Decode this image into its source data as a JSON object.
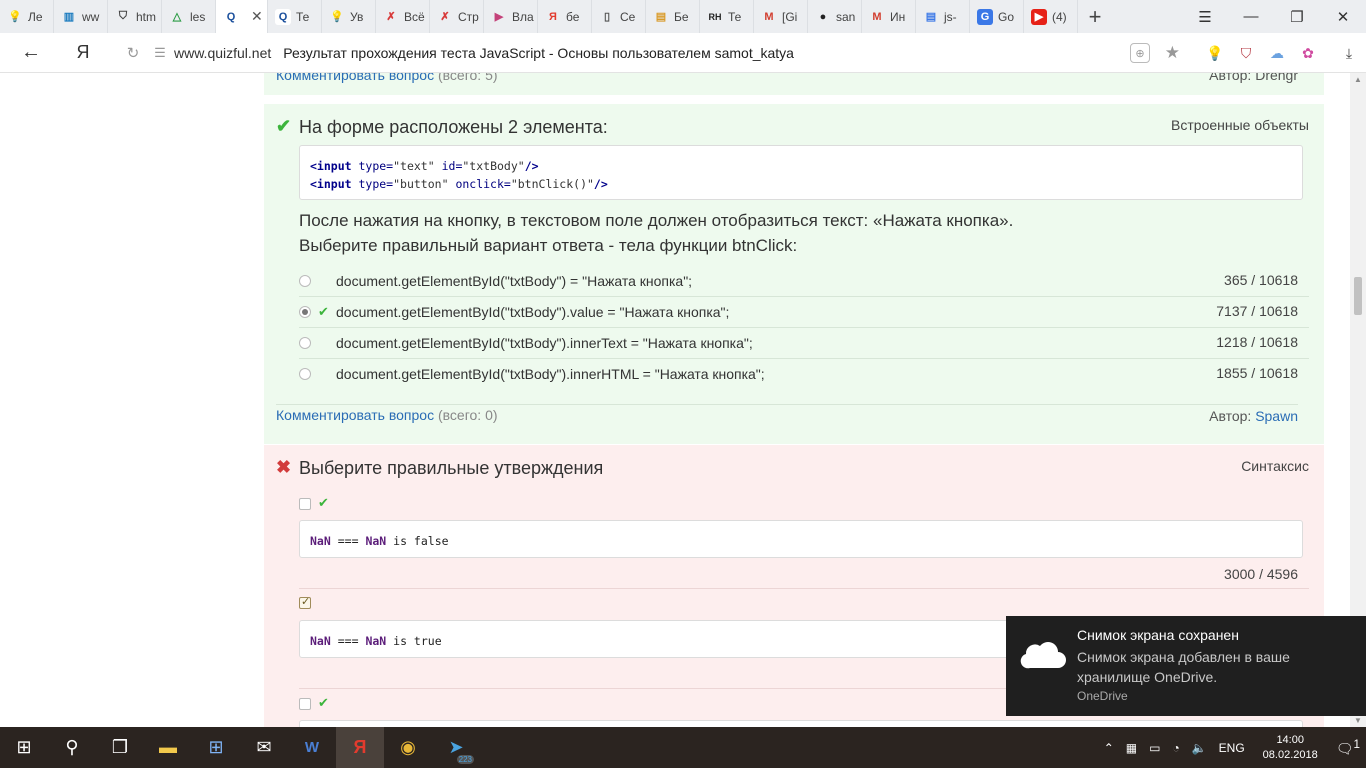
{
  "browser": {
    "tabs": [
      {
        "label": "Ле",
        "icon": "lightbulb-icon"
      },
      {
        "label": "ww",
        "icon": "cisco-icon"
      },
      {
        "label": "htm",
        "icon": "shield-icon"
      },
      {
        "label": "les",
        "icon": "google-drive-icon"
      },
      {
        "label": "",
        "icon": "quizful-icon",
        "active": true
      },
      {
        "label": "Те",
        "icon": "quizful-icon"
      },
      {
        "label": "Ув",
        "icon": "lightbulb-icon"
      },
      {
        "label": "Всё",
        "icon": "vse-icon"
      },
      {
        "label": "Стр",
        "icon": "vse-icon"
      },
      {
        "label": "Вла",
        "icon": "video-icon"
      },
      {
        "label": "бе",
        "icon": "yandex-icon"
      },
      {
        "label": "Се",
        "icon": "document-icon"
      },
      {
        "label": "Бе",
        "icon": "movie-icon"
      },
      {
        "label": "Те",
        "icon": "rh-icon"
      },
      {
        "label": "[Gi",
        "icon": "gmail-icon"
      },
      {
        "label": "san",
        "icon": "github-icon"
      },
      {
        "label": "Ин",
        "icon": "gmail-icon"
      },
      {
        "label": "js-",
        "icon": "docs-icon"
      },
      {
        "label": "Go",
        "icon": "translate-icon"
      },
      {
        "label": "(4)",
        "icon": "youtube-icon"
      }
    ],
    "new_tab": "+",
    "yandex_logo": "Я",
    "url_domain": "www.quizful.net",
    "url_title": "Результат прохождения теста JavaScript - Основы пользователем samot_katya"
  },
  "prev_question": {
    "comment_link": "Комментировать вопрос",
    "comment_count": "(всего: 5)",
    "author_label": "Автор:",
    "author": "Drengr"
  },
  "q1": {
    "status": "correct",
    "title": "На форме расположены 2 элемента:",
    "category": "Встроенные объекты",
    "code_line1": {
      "tag": "<input",
      "a1": "type=",
      "v1": "\"text\"",
      "a2": "id=",
      "v2": "\"txtBody\"",
      "end": "/>"
    },
    "code_line2": {
      "tag": "<input",
      "a1": "type=",
      "v1": "\"button\"",
      "a2": "onclick=",
      "v2": "\"btnClick()\"",
      "end": "/>"
    },
    "text_line1": "После нажатия на кнопку, в текстовом поле должен отобразиться текст: «Нажата кнопка».",
    "text_line2": "Выберите правильный вариант ответа - тела функции btnClick:",
    "answers": [
      {
        "text": "document.getElementById(\"txtBody\") = \"Нажата кнопка\";",
        "stat": "365 / 10618",
        "selected": false,
        "correct": false
      },
      {
        "text": "document.getElementById(\"txtBody\").value = \"Нажата кнопка\";",
        "stat": "7137 / 10618",
        "selected": true,
        "correct": true
      },
      {
        "text": "document.getElementById(\"txtBody\").innerText = \"Нажата кнопка\";",
        "stat": "1218 / 10618",
        "selected": false,
        "correct": false
      },
      {
        "text": "document.getElementById(\"txtBody\").innerHTML = \"Нажата кнопка\";",
        "stat": "1855 / 10618",
        "selected": false,
        "correct": false
      }
    ],
    "comment_link": "Комментировать вопрос",
    "comment_count": "(всего: 0)",
    "author_label": "Автор:",
    "author": "Spawn"
  },
  "q2": {
    "status": "wrong",
    "title": "Выберите правильные утверждения",
    "category": "Синтаксис",
    "statements": [
      {
        "kw1": "NaN",
        "op": "===",
        "kw2": "NaN",
        "rest": "is false",
        "stat": "3000 / 4596",
        "checked": false,
        "correct": true
      },
      {
        "kw1": "NaN",
        "op": "===",
        "kw2": "NaN",
        "rest": "is true",
        "stat": "",
        "checked": true,
        "correct": false
      }
    ],
    "third_checkbox_correct": true
  },
  "toast": {
    "title": "Снимок экрана сохранен",
    "body": "Снимок экрана добавлен в ваше хранилище OneDrive.",
    "source": "OneDrive"
  },
  "taskbar": {
    "telegram_badge": "223",
    "language": "ENG",
    "time": "14:00",
    "date": "08.02.2018",
    "notifications": "1"
  }
}
